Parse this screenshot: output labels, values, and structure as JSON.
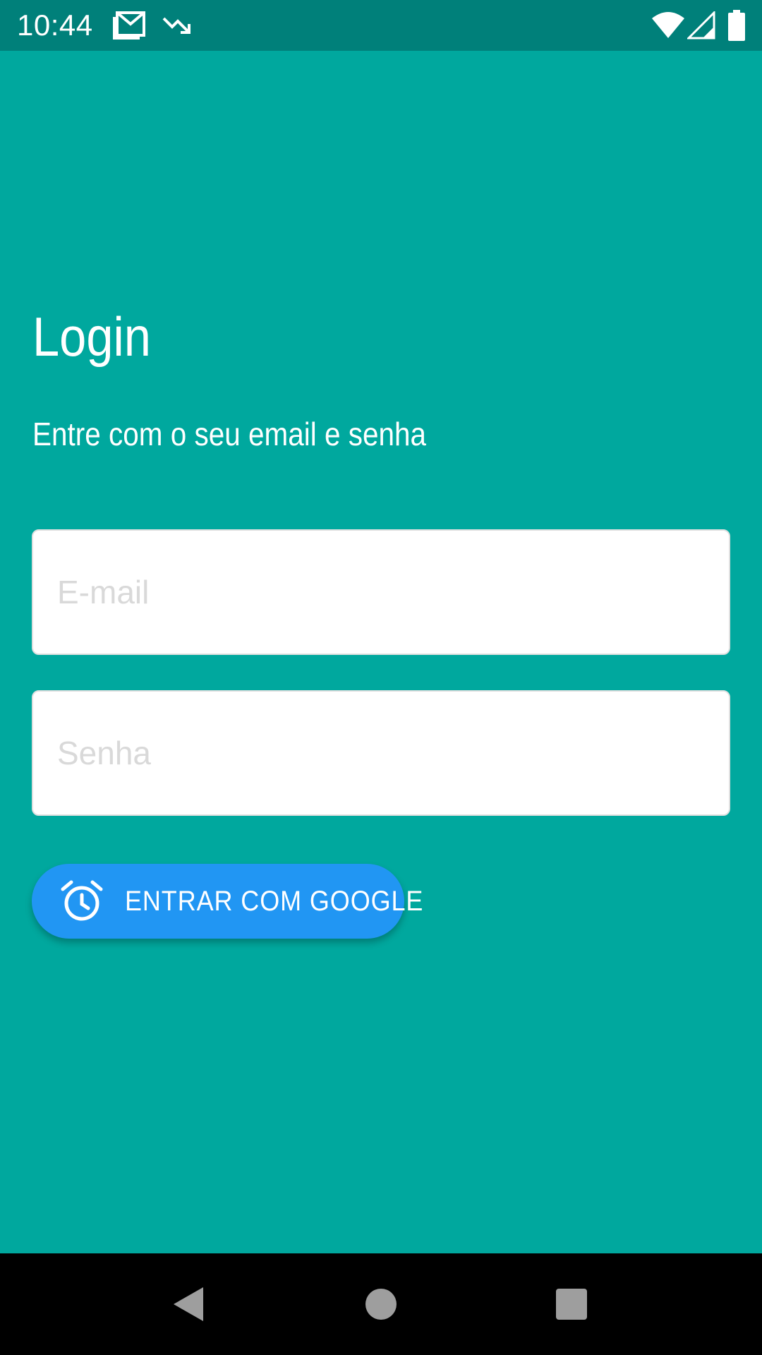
{
  "status_bar": {
    "time": "10:44",
    "icons": [
      "gmail-icon",
      "trending-down-icon",
      "wifi-icon",
      "cellular-signal-icon",
      "battery-icon"
    ]
  },
  "login": {
    "title": "Login",
    "subtitle": "Entre com o seu email e senha",
    "email": {
      "placeholder": "E-mail",
      "value": ""
    },
    "password": {
      "placeholder": "Senha",
      "value": ""
    },
    "google_button": {
      "label": "ENTRAR COM GOOGLE",
      "icon": "alarm-clock-icon"
    }
  },
  "nav_bar": {
    "buttons": [
      "back-icon",
      "home-icon",
      "recents-icon"
    ]
  },
  "colors": {
    "background": "#00a89e",
    "status_bar": "#00807a",
    "button": "#2196f3",
    "placeholder": "#d9d9d9"
  }
}
